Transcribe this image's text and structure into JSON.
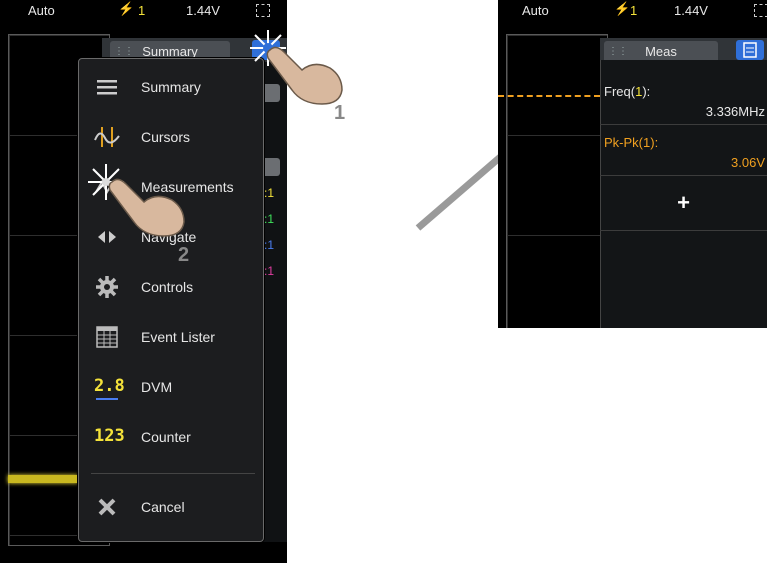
{
  "left_screen": {
    "status": {
      "mode": "Auto",
      "trigger_icon": "trigger-edge-icon",
      "channel": "1",
      "level": "1.44V"
    },
    "tab_label": "Summary",
    "menu": {
      "items": [
        {
          "label": "Summary",
          "icon": "list-icon"
        },
        {
          "label": "Cursors",
          "icon": "cursors-icon"
        },
        {
          "label": "Measurements",
          "icon": "measurements-icon"
        },
        {
          "label": "Navigate",
          "icon": "navigate-icon"
        },
        {
          "label": "Controls",
          "icon": "gear-icon"
        },
        {
          "label": "Event Lister",
          "icon": "table-icon"
        },
        {
          "label": "DVM",
          "icon": "dvm-icon"
        },
        {
          "label": "Counter",
          "icon": "counter-icon"
        }
      ],
      "cancel_label": "Cancel"
    },
    "ch_labels": [
      ":1",
      ":1",
      ":1",
      ":1"
    ],
    "callouts": {
      "step1": "1",
      "step2": "2"
    },
    "dvm_glyph": "2.8",
    "counter_glyph": "123"
  },
  "right_screen": {
    "status": {
      "mode": "Auto",
      "channel": "1",
      "level": "1.44V"
    },
    "tab_label": "Meas",
    "measurements": [
      {
        "name": "Freq",
        "source": "1",
        "value": "3.336MHz"
      },
      {
        "name": "Pk-Pk",
        "source": "1",
        "value": "3.06V"
      }
    ],
    "add_label": "+"
  },
  "colors": {
    "ch1_yellow": "#f4e23a",
    "ch2_green": "#3ee05a",
    "ch3_blue": "#4a7df0",
    "ch4_pink": "#e03ea0",
    "accent_orange": "#f0a020",
    "highlight_blue": "#2f6fd8"
  }
}
